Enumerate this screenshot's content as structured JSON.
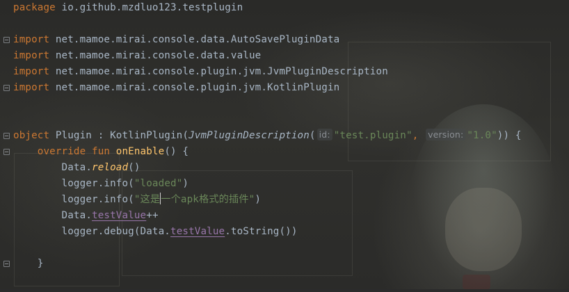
{
  "editor": {
    "line_package": {
      "kw": "package",
      "name": " io.github.mzdluo123.testplugin"
    },
    "imports": [
      {
        "kw": "import",
        "path": " net.mamoe.mirai.console.data.AutoSavePluginData"
      },
      {
        "kw": "import",
        "path": " net.mamoe.mirai.console.data.value"
      },
      {
        "kw": "import",
        "path": " net.mamoe.mirai.console.plugin.jvm.JvmPluginDescription"
      },
      {
        "kw": "import",
        "path": " net.mamoe.mirai.console.plugin.jvm.KotlinPlugin"
      }
    ],
    "line_object": {
      "kw": "object",
      "decl": " Plugin : KotlinPlugin(",
      "call": "JvmPluginDescription",
      "open": "(",
      "hint_id": "id:",
      "str_id": "\"test.plugin\"",
      "comma": ",",
      "hint_version": "version:",
      "str_version": "\"1.0\"",
      "close": ")) {"
    },
    "line_override": {
      "kw": "override fun",
      "fn": " onEnable",
      "rest": "() {"
    },
    "line_reload": {
      "recv": "Data.",
      "method": "reload",
      "rest": "()"
    },
    "line_info1": {
      "head": "logger.info(",
      "str": "\"loaded\"",
      "tail": ")"
    },
    "line_info2": {
      "head": "logger.info(",
      "str_a": "\"这是",
      "str_b": "一个apk格式的插件\"",
      "tail": ")"
    },
    "line_inc": {
      "recv": "Data.",
      "prop": "testValue",
      "rest": "++"
    },
    "line_debug": {
      "head": "logger.debug(Data.",
      "prop": "testValue",
      "rest": ".toString())"
    },
    "line_brace": "}"
  },
  "colors": {
    "background": "#2b2b2b",
    "keyword": "#cc7832",
    "text": "#a9b7c6",
    "function": "#ffc66d",
    "string": "#6a8759",
    "property": "#9876aa",
    "hint": "#8a8e93"
  }
}
